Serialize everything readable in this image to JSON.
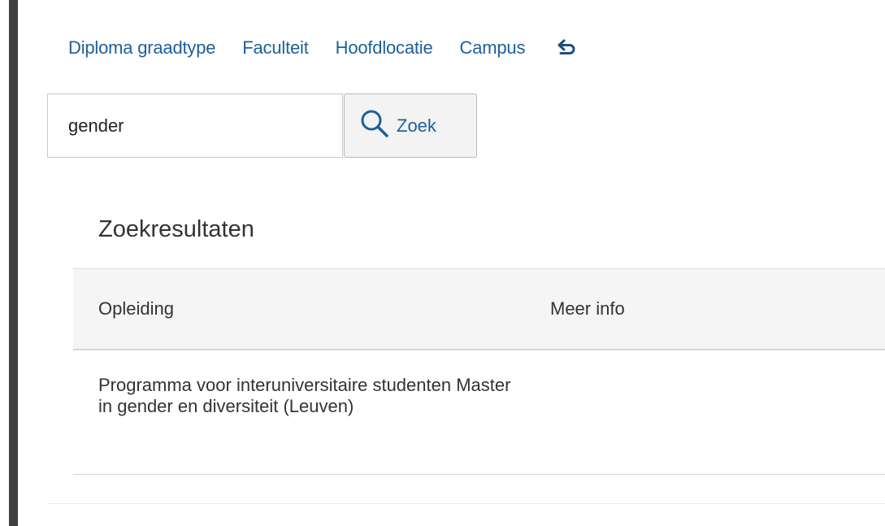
{
  "filters": [
    {
      "label": "Diploma graadtype"
    },
    {
      "label": "Faculteit"
    },
    {
      "label": "Hoofdlocatie"
    },
    {
      "label": "Campus"
    }
  ],
  "reset_icon": "undo-arrow-icon",
  "search": {
    "value": "gender",
    "button_label": "Zoek",
    "button_icon": "search-icon"
  },
  "results": {
    "title": "Zoekresultaten",
    "columns": [
      "Opleiding",
      "Meer info"
    ],
    "rows": [
      {
        "program": "Programma voor interuniversitaire studenten Master in gender en diversiteit (Leuven)",
        "info": ""
      }
    ]
  },
  "colors": {
    "link": "#1f5f9a",
    "header_bg": "#f5f5f5",
    "left_bar": "#3f3f3f"
  }
}
